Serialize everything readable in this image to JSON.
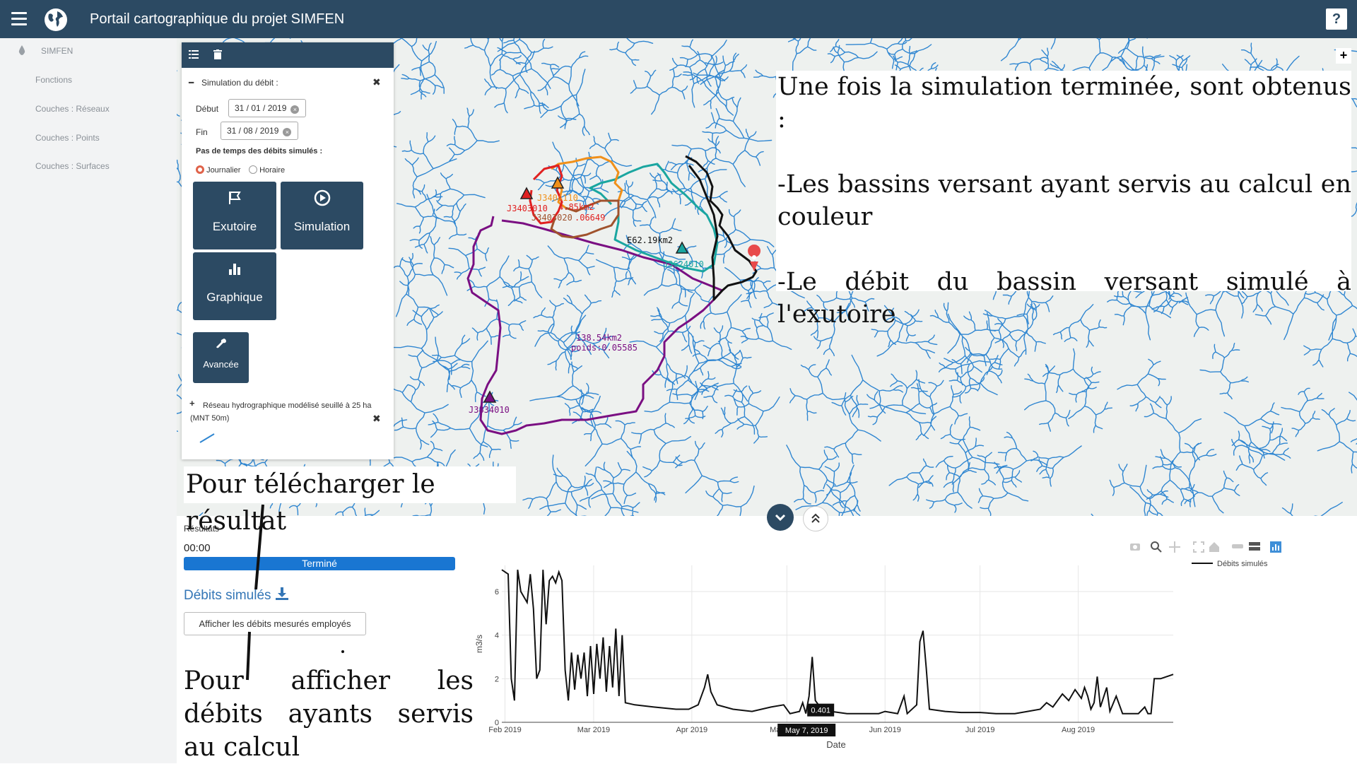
{
  "header": {
    "title": "Portail cartographique du projet SIMFEN",
    "help_label": "?"
  },
  "sidebar": {
    "app_label": "SIMFEN",
    "items": [
      {
        "label": "Fonctions"
      },
      {
        "label": "Couches : Réseaux"
      },
      {
        "label": "Couches : Points"
      },
      {
        "label": "Couches : Surfaces"
      }
    ]
  },
  "panel": {
    "section_title": "Simulation du débit :",
    "debut_label": "Début",
    "debut_value": "31 / 01 / 2019",
    "fin_label": "Fin",
    "fin_value": "31 / 08 / 2019",
    "pas_label": "Pas de temps des débits simulés :",
    "radio_journalier": "Journalier",
    "radio_horaire": "Horaire",
    "btn_exutoire": "Exutoire",
    "btn_simulation": "Simulation",
    "btn_graphique": "Graphique",
    "btn_avancee": "Avancée",
    "reseau_label": "Réseau hydrographique modélisé seuillé à 25 ha (MNT 50m)"
  },
  "map_labels": {
    "station_1": "J3403010",
    "station_2": "J3404110",
    "area_1": "4.85km2",
    "station_3": "J3403020",
    "weight_1": ".06649",
    "area_2": "E62.19km2",
    "station_4": "J3624010",
    "area_3": "138.54km2",
    "weight_3": "poids:0.05585",
    "station_5": "J3834010"
  },
  "annotations": {
    "right_1": "Une fois la simulation terminée, sont obtenus :",
    "right_2": "-Les bassins versant ayant servis au calcul en couleur",
    "right_3": "-Le débit du bassin versant simulé à l'exutoire",
    "download": "Pour télécharger le résultat",
    "display": "Pour afficher les débits ayants servis au calcul"
  },
  "results": {
    "label": "Résultats",
    "timer": "00:00",
    "status": "Terminé",
    "download_link": "Débits simulés",
    "show_measured_button": "Afficher les débits mesurés employés"
  },
  "chart_data": {
    "type": "line",
    "xlabel": "Date",
    "ylabel": "m3/s",
    "x_tick_labels": [
      "Feb 2019",
      "Mar 2019",
      "Apr 2019",
      "May 2019",
      "Jun 2019",
      "Jul 2019",
      "Aug 2019"
    ],
    "y_ticks": [
      0,
      2,
      4,
      6
    ],
    "ylim": [
      0,
      7.2
    ],
    "xlim": [
      "2019-01-31",
      "2019-08-31"
    ],
    "hover_value": "0.401",
    "hover_date": "May 7, 2019",
    "series": [
      {
        "name": "Débits simulés",
        "color": "#111111",
        "points": [
          [
            "2019-01-31",
            7.0
          ],
          [
            "2019-02-02",
            6.8
          ],
          [
            "2019-02-03",
            2.0
          ],
          [
            "2019-02-04",
            1.0
          ],
          [
            "2019-02-05",
            7.0
          ],
          [
            "2019-02-06",
            6.0
          ],
          [
            "2019-02-08",
            5.5
          ],
          [
            "2019-02-09",
            6.8
          ],
          [
            "2019-02-10",
            5.2
          ],
          [
            "2019-02-11",
            2.0
          ],
          [
            "2019-02-12",
            2.4
          ],
          [
            "2019-02-13",
            7.0
          ],
          [
            "2019-02-14",
            4.5
          ],
          [
            "2019-02-15",
            6.5
          ],
          [
            "2019-02-16",
            6.7
          ],
          [
            "2019-02-17",
            6.4
          ],
          [
            "2019-02-18",
            6.9
          ],
          [
            "2019-02-19",
            6.5
          ],
          [
            "2019-02-20",
            2.4
          ],
          [
            "2019-02-21",
            1.0
          ],
          [
            "2019-02-22",
            3.2
          ],
          [
            "2019-02-23",
            1.5
          ],
          [
            "2019-02-24",
            3.1
          ],
          [
            "2019-02-25",
            2.0
          ],
          [
            "2019-02-26",
            3.2
          ],
          [
            "2019-02-27",
            1.2
          ],
          [
            "2019-02-28",
            3.5
          ],
          [
            "2019-03-01",
            1.3
          ],
          [
            "2019-03-02",
            3.6
          ],
          [
            "2019-03-03",
            2.0
          ],
          [
            "2019-03-04",
            3.9
          ],
          [
            "2019-03-05",
            1.4
          ],
          [
            "2019-03-06",
            3.5
          ],
          [
            "2019-03-07",
            1.6
          ],
          [
            "2019-03-08",
            4.3
          ],
          [
            "2019-03-09",
            1.2
          ],
          [
            "2019-03-10",
            4.0
          ],
          [
            "2019-03-11",
            0.9
          ],
          [
            "2019-03-14",
            0.8
          ],
          [
            "2019-03-20",
            0.7
          ],
          [
            "2019-03-27",
            0.6
          ],
          [
            "2019-03-31",
            0.6
          ],
          [
            "2019-04-03",
            0.8
          ],
          [
            "2019-04-05",
            1.6
          ],
          [
            "2019-04-06",
            2.2
          ],
          [
            "2019-04-07",
            1.4
          ],
          [
            "2019-04-09",
            0.8
          ],
          [
            "2019-04-14",
            0.6
          ],
          [
            "2019-04-20",
            0.5
          ],
          [
            "2019-04-26",
            0.7
          ],
          [
            "2019-04-30",
            0.8
          ],
          [
            "2019-05-02",
            0.4
          ],
          [
            "2019-05-05",
            0.5
          ],
          [
            "2019-05-06",
            0.9
          ],
          [
            "2019-05-07",
            0.401
          ],
          [
            "2019-05-08",
            1.2
          ],
          [
            "2019-05-09",
            3.0
          ],
          [
            "2019-05-10",
            1.0
          ],
          [
            "2019-05-12",
            0.6
          ],
          [
            "2019-05-15",
            0.5
          ],
          [
            "2019-05-20",
            0.4
          ],
          [
            "2019-05-25",
            0.4
          ],
          [
            "2019-05-30",
            0.4
          ],
          [
            "2019-06-01",
            0.5
          ],
          [
            "2019-06-05",
            0.4
          ],
          [
            "2019-06-07",
            1.2
          ],
          [
            "2019-06-08",
            0.4
          ],
          [
            "2019-06-11",
            0.8
          ],
          [
            "2019-06-12",
            3.7
          ],
          [
            "2019-06-13",
            4.2
          ],
          [
            "2019-06-14",
            2.5
          ],
          [
            "2019-06-15",
            0.6
          ],
          [
            "2019-06-20",
            0.5
          ],
          [
            "2019-06-25",
            0.45
          ],
          [
            "2019-07-01",
            0.45
          ],
          [
            "2019-07-06",
            0.4
          ],
          [
            "2019-07-12",
            0.4
          ],
          [
            "2019-07-16",
            0.5
          ],
          [
            "2019-07-20",
            0.6
          ],
          [
            "2019-07-22",
            0.9
          ],
          [
            "2019-07-24",
            0.7
          ],
          [
            "2019-07-27",
            1.3
          ],
          [
            "2019-07-29",
            1.0
          ],
          [
            "2019-07-31",
            1.5
          ],
          [
            "2019-08-02",
            1.1
          ],
          [
            "2019-08-03",
            1.6
          ],
          [
            "2019-08-04",
            1.2
          ],
          [
            "2019-08-05",
            0.6
          ],
          [
            "2019-08-06",
            0.9
          ],
          [
            "2019-08-07",
            2.1
          ],
          [
            "2019-08-08",
            0.7
          ],
          [
            "2019-08-10",
            1.6
          ],
          [
            "2019-08-11",
            0.5
          ],
          [
            "2019-08-13",
            1.2
          ],
          [
            "2019-08-15",
            0.4
          ],
          [
            "2019-08-20",
            0.4
          ],
          [
            "2019-08-22",
            0.7
          ],
          [
            "2019-08-23",
            0.4
          ],
          [
            "2019-08-24",
            0.4
          ],
          [
            "2019-08-25",
            2.0
          ],
          [
            "2019-08-27",
            2.0
          ],
          [
            "2019-08-31",
            2.2
          ]
        ]
      }
    ]
  },
  "colors": {
    "header_bg": "#2c4a63",
    "progress_bg": "#1976d2",
    "river_blue": "#2f86d1",
    "basin_red": "#e02020",
    "basin_orange": "#f0901a",
    "basin_brown": "#a0522d",
    "basin_teal": "#1aa6a0",
    "basin_black": "#111111",
    "basin_purple": "#7a0f82"
  }
}
